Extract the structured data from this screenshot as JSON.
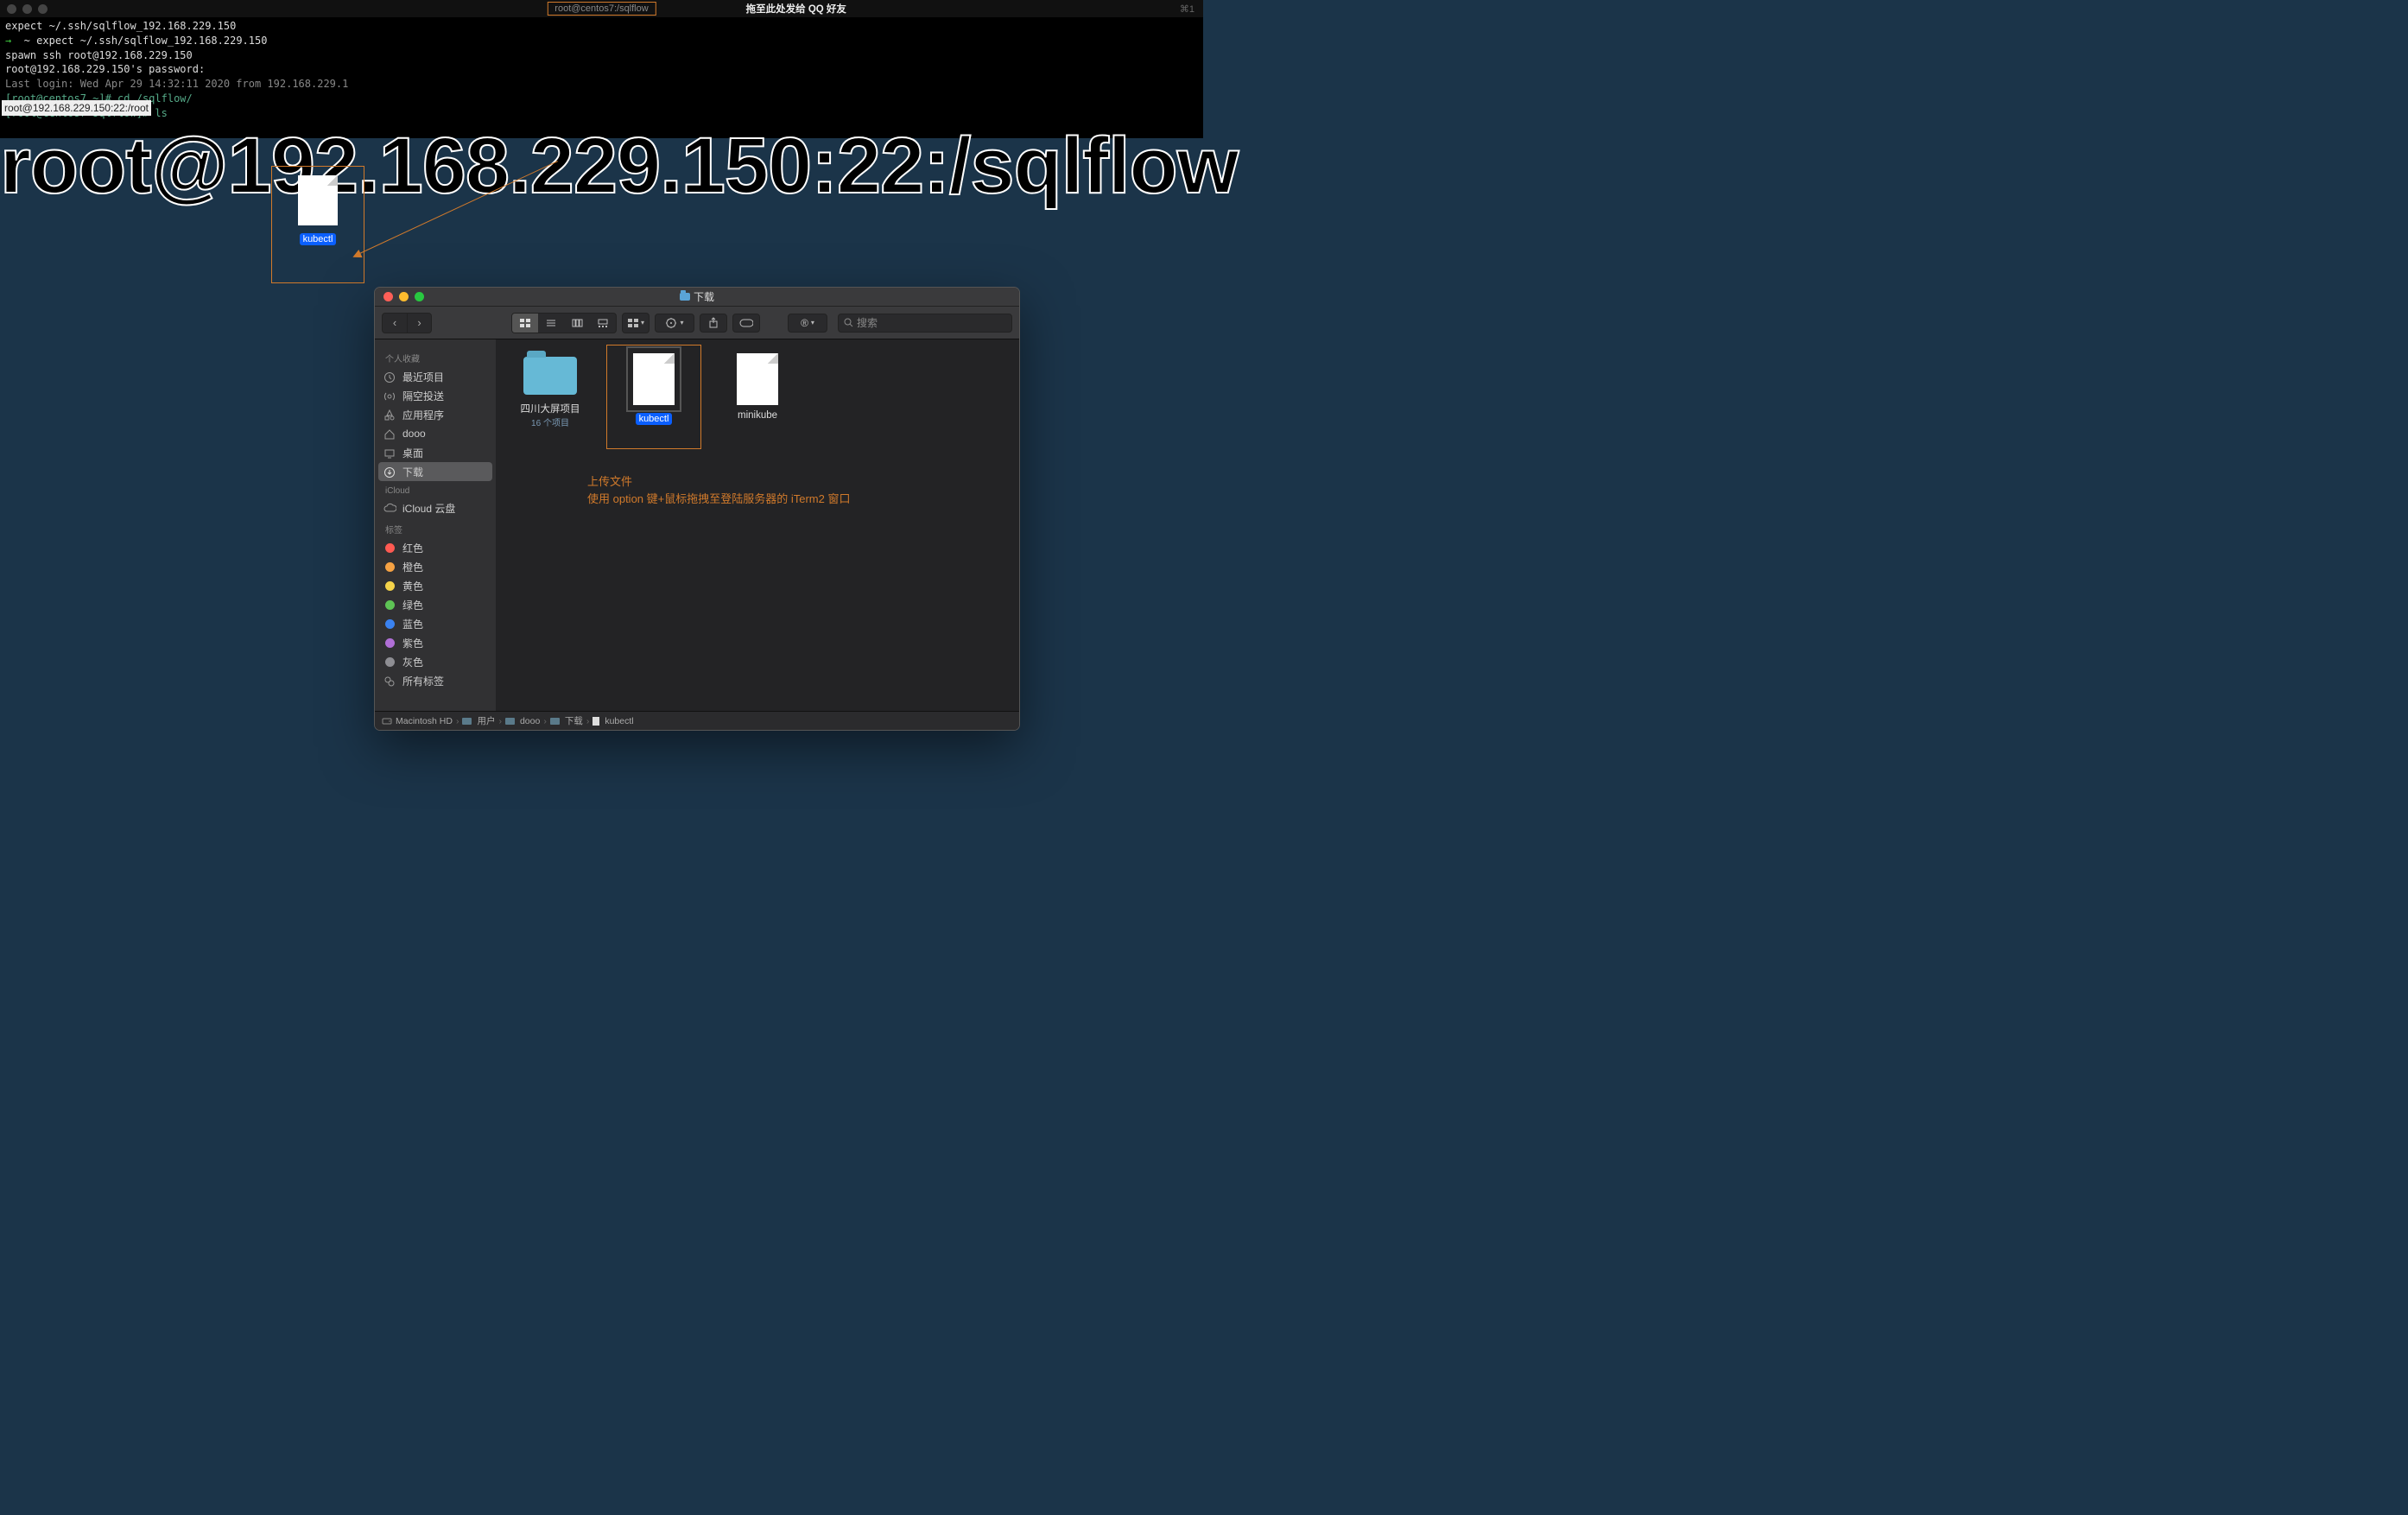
{
  "terminal": {
    "title": "root@centos7:/sqlflow",
    "qq_hint": "拖至此处发给 QQ 好友",
    "right_indicator": "⌘1",
    "lines": [
      "expect ~/.ssh/sqlflow_192.168.229.150",
      "→  ~ expect ~/.ssh/sqlflow_192.168.229.150",
      "spawn ssh root@192.168.229.150",
      "root@192.168.229.150's password:",
      "Last login: Wed Apr 29 14:32:11 2020 from 192.168.229.1",
      "[root@centos7 ~]# cd /sqlflow/",
      "[root@centos7 sqlflow]# ls"
    ],
    "tooltip": "root@192.168.229.150:22:/root"
  },
  "big_overlay": "root@192.168.229.150:22:/sqlflow",
  "dragged_file": {
    "name": "kubectl"
  },
  "finder": {
    "title": "下载",
    "search_placeholder": "搜索",
    "nav": {
      "back": "‹",
      "forward": "›"
    },
    "action_menu_label": "⊙ ▾",
    "sidebar": {
      "section_favorites": "个人收藏",
      "favorites": [
        {
          "label": "最近项目",
          "icon": "clock"
        },
        {
          "label": "隔空投送",
          "icon": "airdrop"
        },
        {
          "label": "应用程序",
          "icon": "apps"
        },
        {
          "label": "dooo",
          "icon": "home"
        },
        {
          "label": "桌面",
          "icon": "desktop"
        },
        {
          "label": "下载",
          "icon": "download",
          "selected": true
        }
      ],
      "section_icloud": "iCloud",
      "icloud": [
        {
          "label": "iCloud 云盘",
          "icon": "cloud"
        }
      ],
      "section_tags": "标签",
      "tags": [
        {
          "label": "红色",
          "color": "#ff5a52"
        },
        {
          "label": "橙色",
          "color": "#f6a243"
        },
        {
          "label": "黄色",
          "color": "#f5d34a"
        },
        {
          "label": "绿色",
          "color": "#5ec455"
        },
        {
          "label": "蓝色",
          "color": "#3a82f0"
        },
        {
          "label": "紫色",
          "color": "#b06fd6"
        },
        {
          "label": "灰色",
          "color": "#8e8e93"
        }
      ],
      "all_tags": "所有标签"
    },
    "items": [
      {
        "name": "四川大屏项目",
        "subtitle": "16 个项目",
        "type": "folder"
      },
      {
        "name": "kubectl",
        "type": "file",
        "selected": true,
        "highlighted": true
      },
      {
        "name": "minikube",
        "type": "file"
      }
    ],
    "pathbar": [
      "Macintosh HD",
      "用户",
      "dooo",
      "下载",
      "kubectl"
    ],
    "path_sep": "›"
  },
  "annotation": {
    "line1": "上传文件",
    "line2": "使用 option 键+鼠标拖拽至登陆服务器的 iTerm2 窗口"
  }
}
